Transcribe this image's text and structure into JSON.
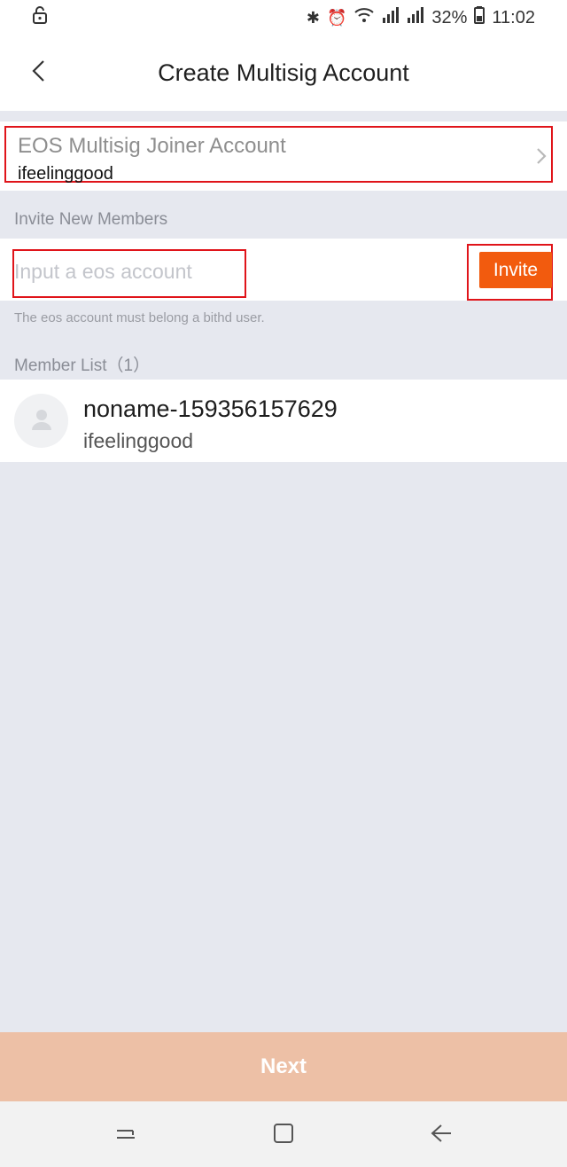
{
  "status_bar": {
    "icons": [
      "lock-icon",
      "bluetooth-icon",
      "alarm-icon",
      "wifi-icon",
      "signal-icon",
      "signal-3g-icon",
      "battery-icon"
    ],
    "battery": "32%",
    "time": "11:02"
  },
  "header": {
    "back_icon": "chevron-left-icon",
    "title": "Create Multisig Account"
  },
  "joiner": {
    "label": "EOS Multisig Joiner Account",
    "value": "ifeelinggood",
    "chevron_icon": "chevron-right-icon"
  },
  "invite": {
    "section_label": "Invite New Members",
    "placeholder": "Input a eos account",
    "button_label": "Invite",
    "hint": "The eos account must belong a bithd user."
  },
  "members": {
    "section_label": "Member List（1）",
    "items": [
      {
        "name": "noname-159356157629",
        "account": "ifeelinggood",
        "avatar_icon": "user-avatar-icon"
      }
    ]
  },
  "footer": {
    "next_label": "Next"
  },
  "nav_bar": {
    "icons": [
      "recent-apps-icon",
      "home-icon",
      "back-icon"
    ]
  },
  "colors": {
    "accent": "#f25b0e",
    "next_disabled": "#edc0a6",
    "highlight_border": "#e0141a",
    "background": "#e6e8ef"
  }
}
